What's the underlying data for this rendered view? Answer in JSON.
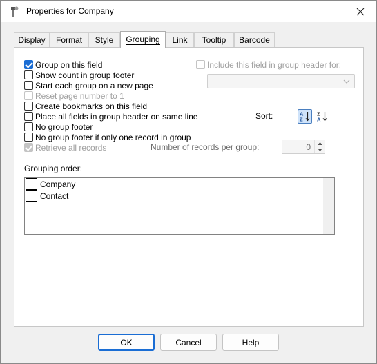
{
  "window": {
    "title": "Properties for Company"
  },
  "tabs": [
    {
      "label": "Display",
      "active": false
    },
    {
      "label": "Format",
      "active": false
    },
    {
      "label": "Style",
      "active": false
    },
    {
      "label": "Grouping",
      "active": true
    },
    {
      "label": "Link",
      "active": false
    },
    {
      "label": "Tooltip",
      "active": false
    },
    {
      "label": "Barcode",
      "active": false
    }
  ],
  "options": {
    "group_on_field": {
      "label": "Group on this field",
      "checked": true,
      "enabled": true
    },
    "show_count": {
      "label": "Show count in group footer",
      "checked": false,
      "enabled": true
    },
    "new_page": {
      "label": "Start each group on a new page",
      "checked": false,
      "enabled": true
    },
    "reset_page": {
      "label": "Reset page number to 1",
      "checked": false,
      "enabled": false
    },
    "bookmarks": {
      "label": "Create bookmarks on this field",
      "checked": false,
      "enabled": true
    },
    "same_line": {
      "label": "Place all fields in group header on same line",
      "checked": false,
      "enabled": true
    },
    "no_footer": {
      "label": "No group footer",
      "checked": false,
      "enabled": true
    },
    "no_footer_single": {
      "label": "No group footer if only one record in group",
      "checked": false,
      "enabled": true
    },
    "retrieve_all": {
      "label": "Retrieve all records",
      "checked": true,
      "enabled": false
    },
    "include_header": {
      "label": "Include this field in group header for:",
      "checked": false,
      "enabled": false
    }
  },
  "include_combo": {
    "value": ""
  },
  "sort": {
    "label": "Sort:",
    "ascending_icon": "sort-az-icon",
    "descending_icon": "sort-za-icon",
    "selected": "ascending"
  },
  "records_per_group": {
    "label": "Number of records per group:",
    "value": "0"
  },
  "grouping_order": {
    "label": "Grouping order:",
    "items": [
      "Company",
      "Contact"
    ]
  },
  "buttons": {
    "ok": "OK",
    "cancel": "Cancel",
    "help": "Help"
  },
  "colors": {
    "accent": "#1a6dd4",
    "panel": "#ffffff",
    "dialog_bg": "#f0f0f0"
  }
}
